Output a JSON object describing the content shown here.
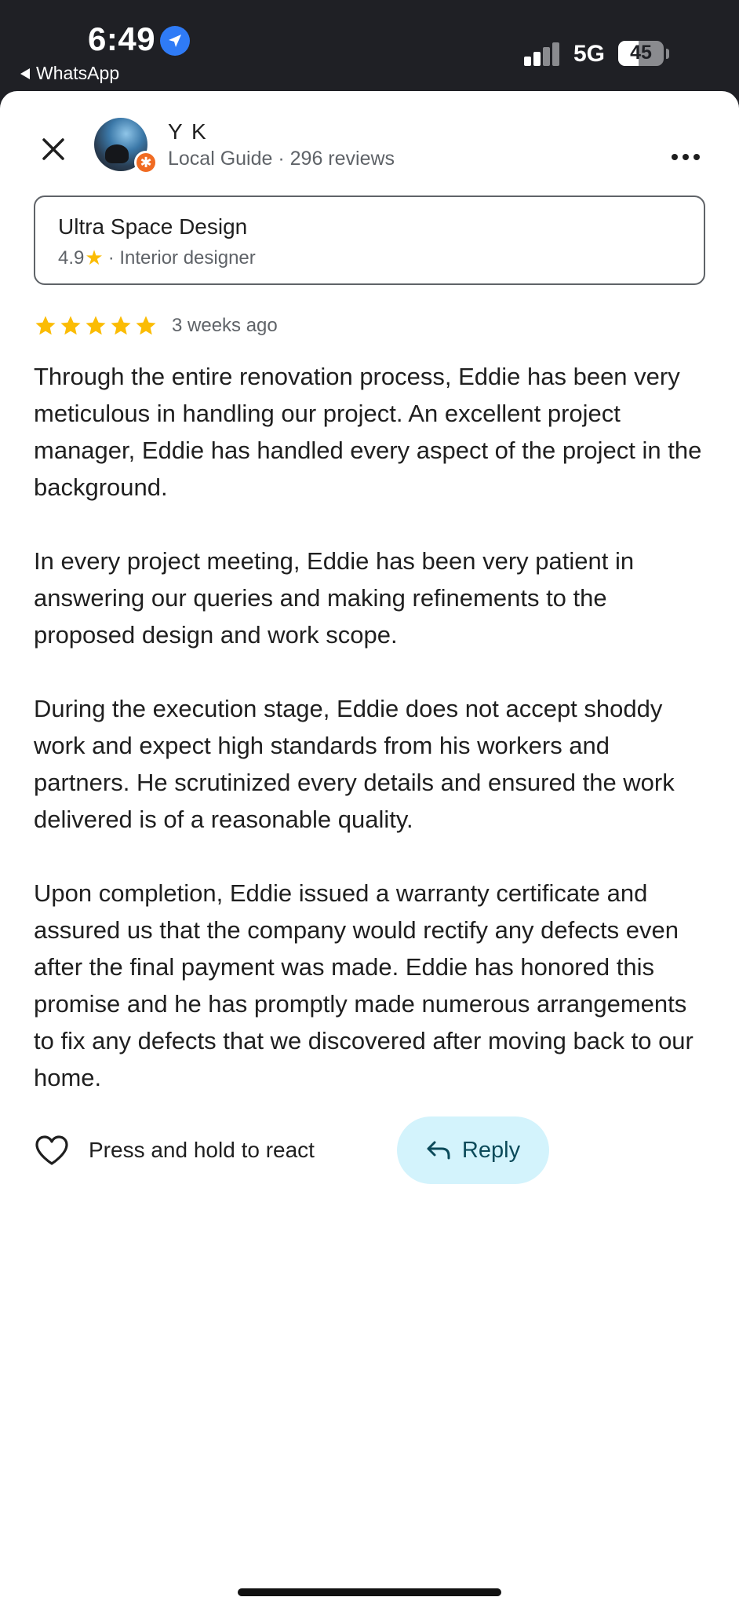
{
  "status_bar": {
    "time": "6:49",
    "back_app": "WhatsApp",
    "network": "5G",
    "battery": "45",
    "battery_level": 0.45
  },
  "reviewer": {
    "name": "Y K",
    "meta": "Local Guide · 296 reviews",
    "badge_icon": "local-guide-badge"
  },
  "place": {
    "name": "Ultra Space Design",
    "rating": "4.9",
    "category": "· Interior designer"
  },
  "review": {
    "stars": 5,
    "time": "3 weeks ago",
    "paragraphs": [
      "Through the entire renovation process, Eddie has been very meticulous in handling our project. An excellent project manager, Eddie has handled every aspect of the project in the background.",
      "In every project meeting, Eddie has been very patient in answering our queries and making refinements to the proposed design and work scope.",
      "During the execution stage, Eddie does not accept shoddy work and expect high standards from his workers and partners. He scrutinized every details and ensured the work delivered is of a reasonable quality.",
      "Upon completion, Eddie issued a warranty certificate and assured us that the company would rectify any defects even after the final payment was made. Eddie has honored this promise and he has promptly made numerous arrangements to fix any defects that we discovered after moving back to our home."
    ]
  },
  "actions": {
    "react_label": "Press and hold to react",
    "reply_label": "Reply"
  },
  "colors": {
    "star": "#fbbc04",
    "reply_bg": "#d3f3fc",
    "guide_badge": "#f06b22",
    "status_bar_bg": "#1f2025"
  }
}
